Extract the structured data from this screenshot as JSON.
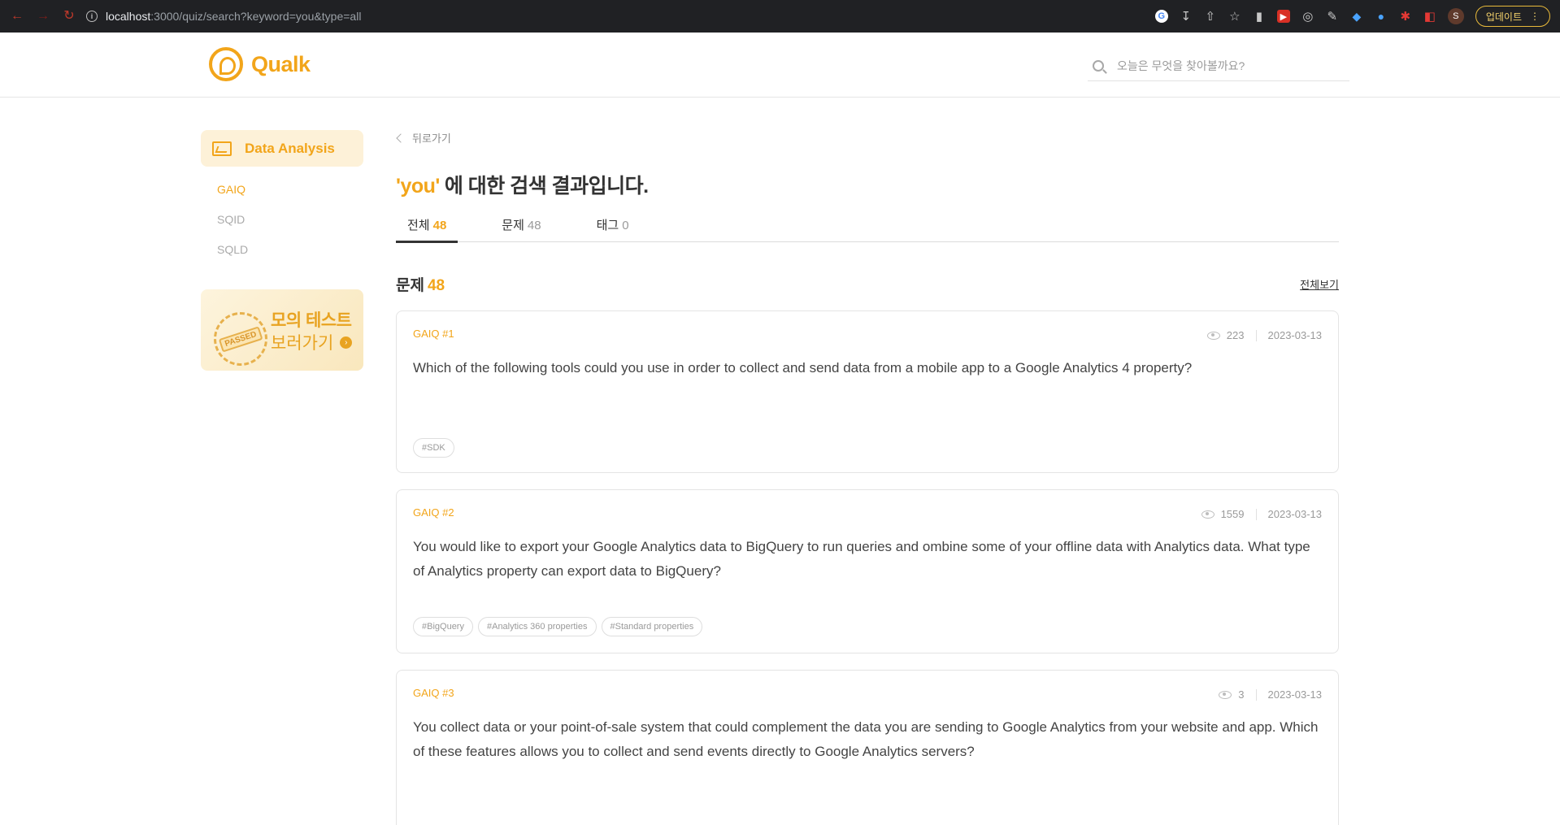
{
  "browser": {
    "url_host": "localhost",
    "url_path": ":3000/quiz/search?keyword=you&type=all",
    "profile_initial": "S",
    "update_label": "업데이트"
  },
  "header": {
    "logo_text": "Qualk",
    "search_placeholder": "오늘은 무엇을 찾아볼까요?"
  },
  "sidebar": {
    "category_title": "Data Analysis",
    "items": [
      {
        "label": "GAIQ",
        "active": true
      },
      {
        "label": "SQID",
        "active": false
      },
      {
        "label": "SQLD",
        "active": false
      }
    ],
    "promo": {
      "title": "모의 테스트",
      "subtitle": "보러가기",
      "seal_text": "PASSED"
    }
  },
  "main": {
    "back_label": "뒤로가기",
    "keyword": "'you'",
    "heading_suffix": "에 대한 검색 결과입니다.",
    "tabs": [
      {
        "label": "전체",
        "count": "48",
        "active": true
      },
      {
        "label": "문제",
        "count": "48",
        "active": false
      },
      {
        "label": "태그",
        "count": "0",
        "active": false
      }
    ],
    "section_title": "문제",
    "section_count": "48",
    "view_all": "전체보기",
    "questions": [
      {
        "num": "GAIQ #1",
        "views": "223",
        "date": "2023-03-13",
        "text": "Which of the following tools could you use in order to collect and send data from a mobile app to a Google Analytics 4 property?",
        "tags": [
          "#SDK"
        ]
      },
      {
        "num": "GAIQ #2",
        "views": "1559",
        "date": "2023-03-13",
        "text": "You would like to export your Google Analytics data to BigQuery to run queries and ombine some of your offline data with Analytics data. What type of Analytics property can export data to BigQuery?",
        "tags": [
          "#BigQuery",
          "#Analytics 360 properties",
          "#Standard properties"
        ]
      },
      {
        "num": "GAIQ #3",
        "views": "3",
        "date": "2023-03-13",
        "text": "You collect data or your point-of-sale system that could complement the data you are sending to Google Analytics from your website and app. Which of these features allows you to collect and send events directly to Google Analytics servers?",
        "tags": []
      }
    ]
  }
}
